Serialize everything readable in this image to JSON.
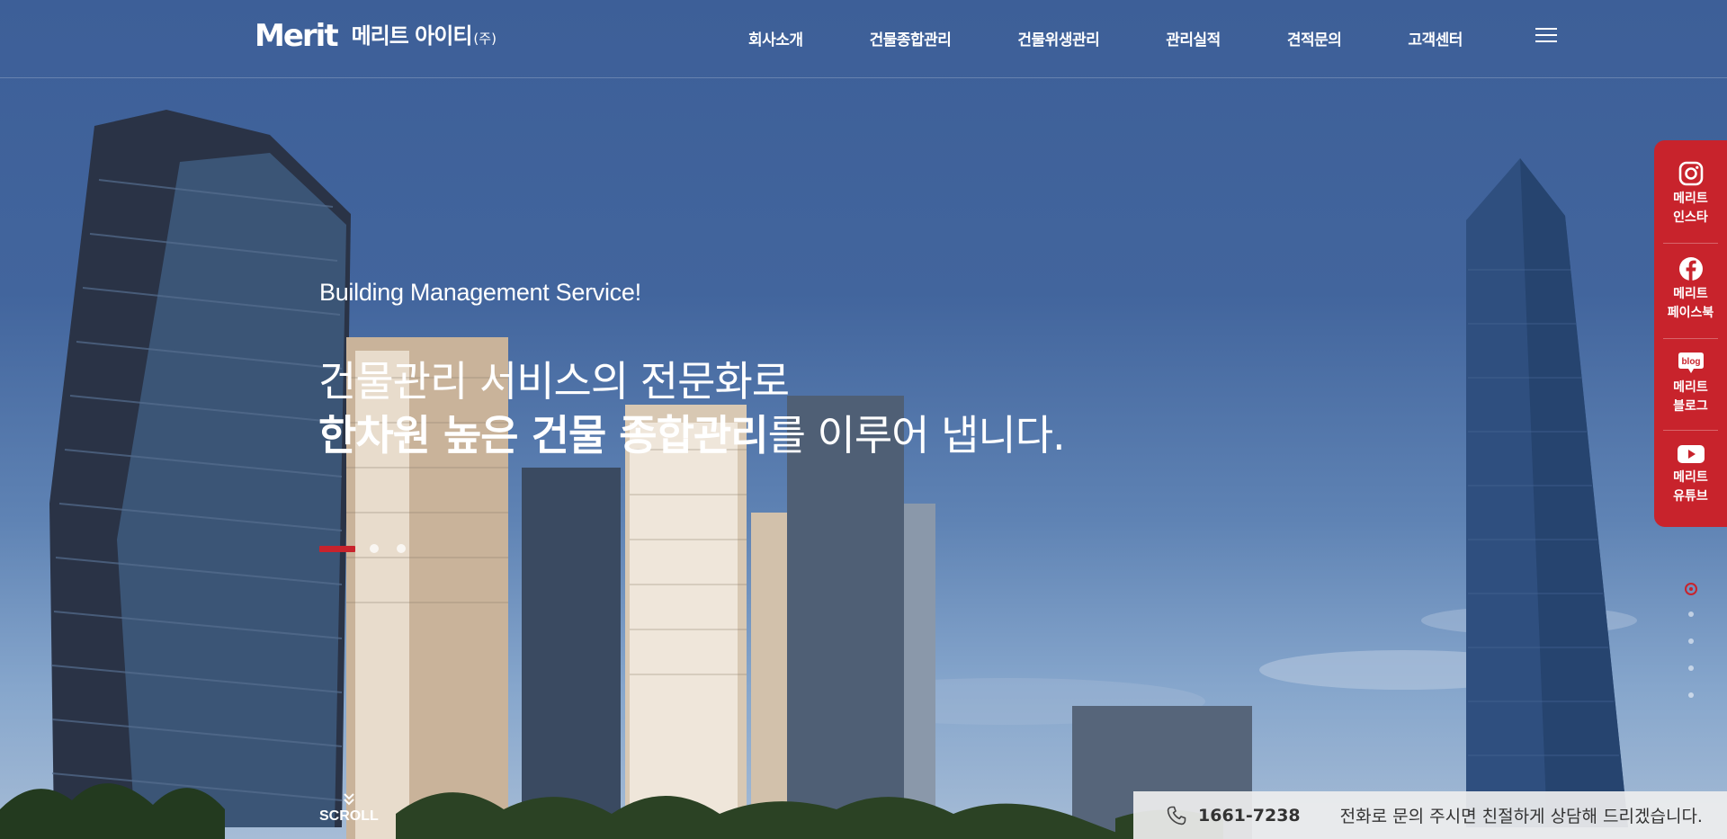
{
  "header": {
    "logo_mark": "Merit",
    "logo_kor": "메리트 아이티",
    "logo_corp": "(주)",
    "nav": [
      "회사소개",
      "건물종합관리",
      "건물위생관리",
      "관리실적",
      "견적문의",
      "고객센터"
    ]
  },
  "hero": {
    "sub": "Building Management Service!",
    "line1": "건물관리 서비스의 전문화로",
    "line2_bold": "한차원 높은 건물 종합관리",
    "line2_rest": "를 이루어 냅니다."
  },
  "scroll_label": "SCROLL",
  "sns": [
    {
      "line1": "메리트",
      "line2": "인스타",
      "icon": "instagram-icon"
    },
    {
      "line1": "메리트",
      "line2": "페이스북",
      "icon": "facebook-icon"
    },
    {
      "line1": "메리트",
      "line2": "블로그",
      "icon": "blog-icon",
      "badge": "blog"
    },
    {
      "line1": "메리트",
      "line2": "유튜브",
      "icon": "youtube-icon"
    }
  ],
  "contact": {
    "phone": "1661-7238",
    "message": "전화로 문의 주시면 친절하게 상담해 드리겠습니다."
  },
  "colors": {
    "accent": "#c8232c",
    "sky": "#42659d"
  }
}
